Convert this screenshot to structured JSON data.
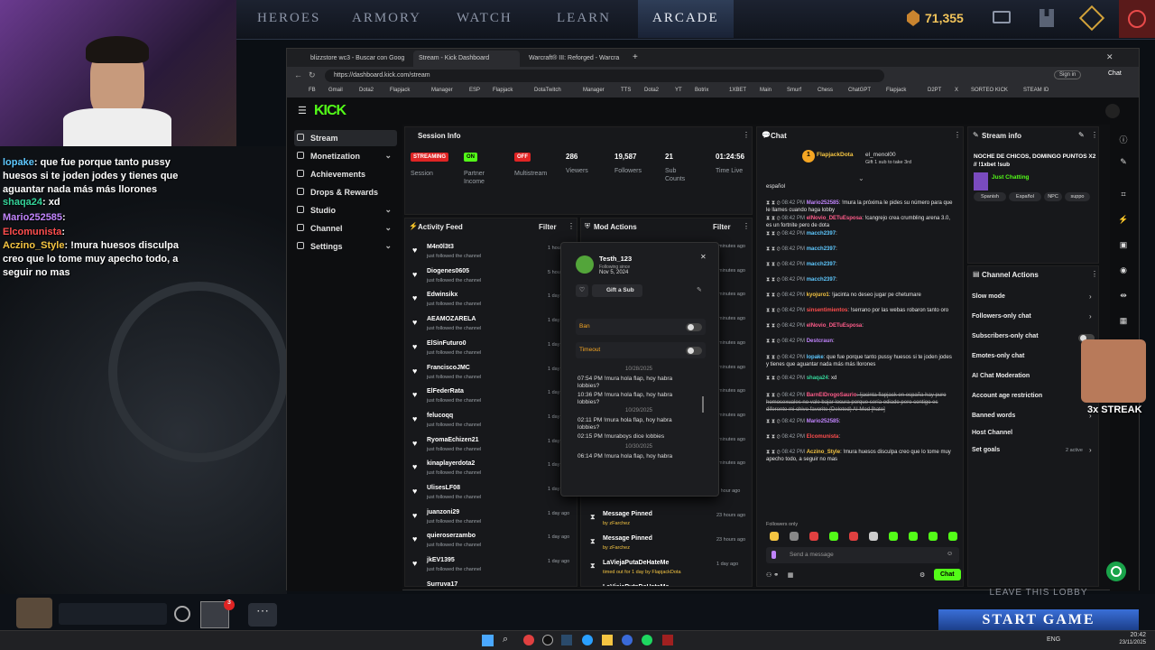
{
  "game_nav": {
    "items": [
      "HEROES",
      "ARMORY",
      "WATCH",
      "LEARN",
      "ARCADE"
    ],
    "gold": "71,355"
  },
  "overlay_chat": [
    {
      "user": "lopake",
      "text": ": que fue porque tanto pussy huesos si te joden jodes y tienes que aguantar nada más más llorones"
    },
    {
      "user": "shaqa24",
      "text": ": xd"
    },
    {
      "user": "Mario252585",
      "text": ":"
    },
    {
      "user": "Elcomunista",
      "text": ":"
    },
    {
      "user": "Aczino_Style",
      "text": ": !mura huesos disculpa creo que lo tome muy apecho todo, a seguir no mas"
    }
  ],
  "browser": {
    "tabs": [
      "blizzstore wc3 - Buscar con Goog",
      "Stream - Kick Dashboard",
      "Warcraft® III: Reforged - Warcra"
    ],
    "url": "https://dashboard.kick.com/stream",
    "bookmarks": [
      "FB",
      "Gmail",
      "Dota2",
      "Flapjack",
      "Manager",
      "ESP",
      "Flapjack",
      "DotaTwitch",
      "Manager",
      "TTS",
      "Dota2",
      "YT",
      "Botrix",
      "1XBET",
      "Main",
      "Smurf",
      "Chess",
      "ChatGPT",
      "Flapjack",
      "D2PT",
      "X",
      "SORTEO KICK",
      "STEAM ID"
    ],
    "profile_btn": "Sign in",
    "chat_btn": "Chat"
  },
  "kick": {
    "logo": "KICK",
    "sidebar": [
      "Stream",
      "Monetization",
      "Achievements",
      "Drops & Rewards",
      "Studio",
      "Channel",
      "Settings"
    ],
    "session": {
      "title": "Session Info",
      "items": [
        {
          "badge": "STREAMING",
          "label": "Session"
        },
        {
          "badge": "ON",
          "label": "Partner Income"
        },
        {
          "badge": "OFF",
          "label": "Multistream"
        },
        {
          "value": "286",
          "label": "Viewers"
        },
        {
          "value": "19,587",
          "label": "Followers"
        },
        {
          "value": "21",
          "label": "Sub Counts"
        },
        {
          "value": "01:24:56",
          "label": "Time Live"
        }
      ]
    },
    "activity": {
      "title": "Activity Feed",
      "filter": "Filter",
      "items": [
        {
          "name": "M4n0l3t3",
          "time": "1 hour"
        },
        {
          "name": "Diogenes0605",
          "time": "5 hours"
        },
        {
          "name": "Edwinsikx",
          "time": "1 day ago"
        },
        {
          "name": "AEAMOZARELA",
          "time": "1 day ago"
        },
        {
          "name": "ElSinFuturo0",
          "time": "1 day ago"
        },
        {
          "name": "FranciscoJMC",
          "time": "1 day ago"
        },
        {
          "name": "ElFederRata",
          "time": "1 day ago"
        },
        {
          "name": "felucoqq",
          "time": "1 day ago"
        },
        {
          "name": "RyomaEchizen21",
          "time": "1 day ago"
        },
        {
          "name": "kinaplayerdota2",
          "time": "1 day ago"
        },
        {
          "name": "UlisesLF08",
          "time": "1 day ago"
        },
        {
          "name": "juanzoni29",
          "time": "1 day ago"
        },
        {
          "name": "quieroserzambo",
          "time": "1 day ago"
        },
        {
          "name": "jkEV1395",
          "time": "1 day ago"
        },
        {
          "name": "Surruya17",
          "time": ""
        }
      ],
      "sub": "just followed the channel"
    },
    "mod": {
      "title": "Mod Actions",
      "filter": "Filter",
      "times": [
        "minutes ago",
        "minutes ago",
        "minutes ago",
        "minutes ago",
        "minutes ago",
        "minutes ago",
        "minutes ago",
        "minutes ago",
        "minutes ago",
        "minutes ago"
      ],
      "items": [
        {
          "title": "timed out for 5 minutes by FlapjackDota",
          "by": "",
          "time": "1 hour ago"
        },
        {
          "title": "Message Pinned",
          "by": "by zFarchez",
          "time": "23 hours ago"
        },
        {
          "title": "Message Pinned",
          "by": "by zFarchez",
          "time": "23 hours ago"
        },
        {
          "title": "LaViejaPutaDeHateMe",
          "by": "timed out for 1 day by FlapjackDota",
          "time": "1 day ago"
        },
        {
          "title": "LaViejaPutaDeHateMe",
          "by": "",
          "time": ""
        }
      ]
    },
    "popup": {
      "username": "Testh_123",
      "following_label": "Following since",
      "following_date": "Nov 5, 2024",
      "gift": "Gift a Sub",
      "ban": "Ban",
      "timeout": "Timeout",
      "history": [
        {
          "type": "date",
          "text": "10/28/2025"
        },
        {
          "type": "msg",
          "time": "07:54 PM",
          "text": "!mura hola flap, hoy habra lobbies?"
        },
        {
          "type": "msg",
          "time": "10:36 PM",
          "text": "!mura hola flap, hoy habra lobbies?"
        },
        {
          "type": "date",
          "text": "10/29/2025"
        },
        {
          "type": "msg",
          "time": "02:11 PM",
          "text": "!mura hola flap, hoy habra lobbies?"
        },
        {
          "type": "msg",
          "time": "02:15 PM",
          "text": "!muraboys dice lobbies"
        },
        {
          "type": "date",
          "text": "10/30/2025"
        },
        {
          "type": "msg",
          "time": "06:14 PM",
          "text": "!mura hola flap, hoy habra"
        }
      ]
    },
    "chat": {
      "title": "Chat",
      "pinned_user": "FlapjackDota",
      "pinned_user2": "el_menol00",
      "pinned_text": "Gift 1 sub to take 3rd",
      "top_text": "español",
      "lines": [
        {
          "t": "08:42 PM",
          "u": "Mario252585",
          "c": "#c084fc",
          "m": ": !mura la próxima le pides su número para que le llames cuando haga lobby"
        },
        {
          "t": "08:42 PM",
          "u": "elNovio_DETuEsposa",
          "c": "#ff5c8a",
          "m": ": !cangrejo crea crumbling arena 3.0, es un fortnite pero de dota"
        },
        {
          "t": "08:42 PM",
          "u": "macch2397",
          "c": "#5ec8ff",
          "m": ":"
        },
        {
          "t": "08:42 PM",
          "u": "macch2397",
          "c": "#5ec8ff",
          "m": ":"
        },
        {
          "t": "08:42 PM",
          "u": "macch2397",
          "c": "#5ec8ff",
          "m": ":"
        },
        {
          "t": "08:42 PM",
          "u": "macch2397",
          "c": "#5ec8ff",
          "m": ":"
        },
        {
          "t": "08:42 PM",
          "u": "kyojuro1",
          "c": "#f5c542",
          "m": ": !jacinta no deseo jugar pe chetumare"
        },
        {
          "t": "08:42 PM",
          "u": "sinsentimientos",
          "c": "#ff4d4d",
          "m": ": !serrano por las webas robaron tanto oro"
        },
        {
          "t": "08:42 PM",
          "u": "elNovio_DETuEsposa",
          "c": "#ff5c8a",
          "m": ":"
        },
        {
          "t": "08:42 PM",
          "u": "Destcraun",
          "c": "#c084fc",
          "m": ":"
        },
        {
          "t": "08:42 PM",
          "u": "lopake",
          "c": "#5ec8ff",
          "m": ": que fue porque tanto pussy huesos si te joden jodes y tienes que aguantar nada más más llorones"
        },
        {
          "t": "08:42 PM",
          "u": "shaqa24",
          "c": "#34d399",
          "m": ": xd"
        },
        {
          "t": "08:42 PM",
          "u": "BarnElDrogoSaurio",
          "c": "#ff5c8a",
          "m": ": !jacinta flapjack en españa hay puro homosexuales no vale bajar locura porque sería odiado pero contigo es diferente mi chivo favorito (Deleted) AI Mod [hate]"
        },
        {
          "t": "08:42 PM",
          "u": "Mario252585",
          "c": "#c084fc",
          "m": ":"
        },
        {
          "t": "08:42 PM",
          "u": "Elcomunista",
          "c": "#ff4d4d",
          "m": ":"
        },
        {
          "t": "08:42 PM",
          "u": "Aczino_Style",
          "c": "#f5c542",
          "m": ": !mura huesos disculpa creo que lo tome muy apecho todo, a seguir no mas"
        }
      ],
      "followers_only": "Followers only",
      "placeholder": "Send a message",
      "send": "Chat"
    },
    "stream_info": {
      "title": "Stream info",
      "stream_title": "NOCHE DE CHICOS, DOMINGO PUNTOS X2 // !1xbet !sub",
      "category": "Just Chatting",
      "tags": [
        "Spanish",
        "Español",
        "NPC",
        "suppo"
      ]
    },
    "channel_actions": {
      "title": "Channel Actions",
      "items": [
        "Slow mode",
        "Followers-only chat",
        "Subscribers-only chat",
        "Emotes-only chat",
        "AI Chat Moderation",
        "Account age restriction",
        "Banned words",
        "Host Channel",
        "Set goals"
      ],
      "goals_badge": "2 active"
    }
  },
  "game_overlay": {
    "streak": "3x STREAK",
    "leave": "LEAVE THIS LOBBY",
    "start": "START GAME",
    "notif_count": "3"
  },
  "taskbar": {
    "lang": "ENG",
    "time": "20:42",
    "date": "23/11/2025"
  },
  "colors": {
    "kick_green": "#53fc18",
    "streaming_red": "#e02424"
  }
}
